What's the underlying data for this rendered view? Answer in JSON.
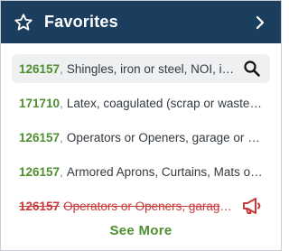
{
  "header": {
    "title": "Favorites"
  },
  "items": [
    {
      "code": "126157",
      "desc": "Shingles, iron or steel, NOI, in bo...",
      "state": "active"
    },
    {
      "code": "171710",
      "desc": "Latex, coagulated (scrap or waste lat...",
      "state": "normal"
    },
    {
      "code": "126157",
      "desc": "Operators or Openers, garage or co...",
      "state": "normal"
    },
    {
      "code": "126157",
      "desc": "Armored Aprons, Curtains, Mats or V...",
      "state": "normal"
    },
    {
      "code": "126157",
      "desc": "Operators or Openers, garage or...",
      "state": "struck"
    }
  ],
  "footer": {
    "see_more_label": "See More"
  },
  "colors": {
    "header_bg": "#1b3e5e",
    "code_green": "#4f8f2f",
    "alert_red": "#c93a3a"
  },
  "icons": {
    "header": "star-outline-icon",
    "header_action": "chevron-right-icon",
    "active_row": "search-icon",
    "struck_row": "megaphone-icon"
  }
}
